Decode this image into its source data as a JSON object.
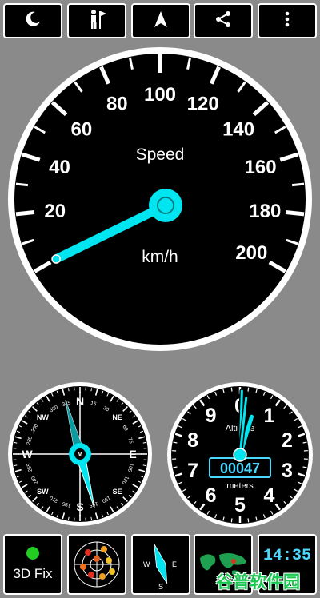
{
  "toolbar": {
    "buttons": [
      {
        "icon": "moon-icon"
      },
      {
        "icon": "hiker-icon"
      },
      {
        "icon": "navigation-arrow-icon"
      },
      {
        "icon": "share-icon"
      },
      {
        "icon": "more-vert-icon"
      }
    ]
  },
  "speedometer": {
    "title": "Speed",
    "unit": "km/h",
    "tick_labels": [
      "20",
      "40",
      "60",
      "80",
      "100",
      "120",
      "140",
      "160",
      "180",
      "200"
    ],
    "value_kmh": 0,
    "needle_color": "#00e5ef"
  },
  "compass": {
    "cardinals": [
      "N",
      "E",
      "S",
      "W"
    ],
    "intercardinals": [
      "NE",
      "SE",
      "SW",
      "NW"
    ],
    "degree_labels": [
      "15",
      "30",
      "60",
      "75",
      "105",
      "120",
      "150",
      "165",
      "195",
      "210",
      "240",
      "255",
      "285",
      "300",
      "330",
      "345"
    ],
    "center_label": "M",
    "heading_deg": 165
  },
  "altimeter": {
    "title": "Altitude",
    "digits": [
      "0",
      "1",
      "2",
      "3",
      "4",
      "5",
      "6",
      "7",
      "8",
      "9"
    ],
    "readout": "00047",
    "unit": "meters"
  },
  "bottom_bar": {
    "gps_status": "3D Fix",
    "gps_indicator_color": "#22cc22",
    "clock_text": "14:35",
    "watermark": "谷普软件园"
  }
}
